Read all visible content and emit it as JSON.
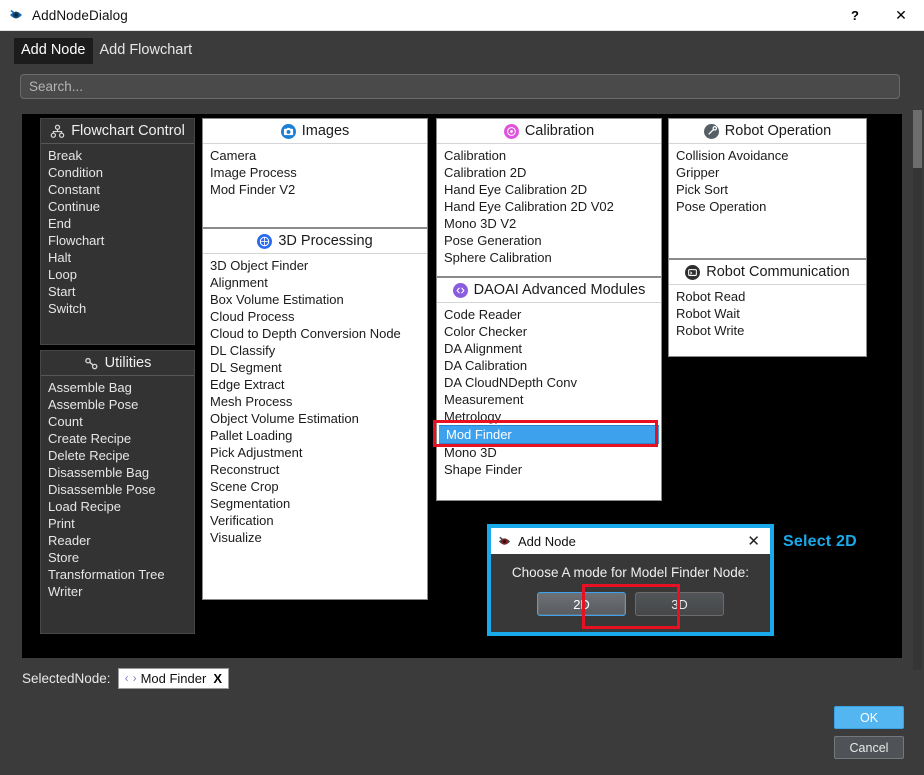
{
  "window": {
    "title": "AddNodeDialog",
    "icon": "app-eye-icon",
    "help_label": "?",
    "close_label": "✕"
  },
  "tabs": [
    {
      "label": "Add Node",
      "active": true
    },
    {
      "label": "Add Flowchart",
      "active": false
    }
  ],
  "search": {
    "placeholder": "Search...",
    "value": ""
  },
  "panels": {
    "flowchart_control": {
      "title": "Flowchart Control",
      "icon": "sitemap-icon",
      "items": [
        "Break",
        "Condition",
        "Constant",
        "Continue",
        "End",
        "Flowchart",
        "Halt",
        "Loop",
        "Start",
        "Switch"
      ]
    },
    "utilities": {
      "title": "Utilities",
      "icon": "wrench-icon",
      "items": [
        "Assemble Bag",
        "Assemble Pose",
        "Count",
        "Create Recipe",
        "Delete Recipe",
        "Disassemble Bag",
        "Disassemble Pose",
        "Load Recipe",
        "Print",
        "Reader",
        "Store",
        "Transformation Tree",
        "Writer"
      ]
    },
    "images": {
      "title": "Images",
      "icon": "camera-icon",
      "icon_color": "#1a7fd4",
      "items": [
        "Camera",
        "Image Process",
        "Mod Finder V2"
      ]
    },
    "processing_3d": {
      "title": "3D Processing",
      "icon": "cube-icon",
      "icon_color": "#2a6cf0",
      "items": [
        "3D Object Finder",
        "Alignment",
        "Box Volume Estimation",
        "Cloud Process",
        "Cloud to Depth Conversion Node",
        "DL Classify",
        "DL Segment",
        "Edge Extract",
        "Mesh Process",
        "Object Volume Estimation",
        "Pallet Loading",
        "Pick Adjustment",
        "Reconstruct",
        "Scene Crop",
        "Segmentation",
        "Verification",
        "Visualize"
      ]
    },
    "calibration": {
      "title": "Calibration",
      "icon": "target-icon",
      "icon_color": "#e052e0",
      "items": [
        "Calibration",
        "Calibration 2D",
        "Hand Eye Calibration 2D",
        "Hand Eye Calibration 2D V02",
        "Mono 3D V2",
        "Pose Generation",
        "Sphere Calibration"
      ]
    },
    "daoai_advanced": {
      "title": "DAOAI Advanced Modules",
      "icon": "code-brackets-icon",
      "icon_color": "#8a5ce0",
      "items": [
        "Code Reader",
        "Color Checker",
        "DA Alignment",
        "DA Calibration",
        "DA CloudNDepth Conv",
        "Measurement",
        "Metrology",
        "Mod Finder",
        "Mono 3D",
        "Shape Finder"
      ],
      "selected_item": "Mod Finder"
    },
    "robot_operation": {
      "title": "Robot Operation",
      "icon": "wrench-round-icon",
      "icon_color": "#555f66",
      "items": [
        "Collision Avoidance",
        "Gripper",
        "Pick Sort",
        "Pose Operation"
      ]
    },
    "robot_communication": {
      "title": "Robot Communication",
      "icon": "terminal-icon",
      "icon_color": "#2e2e2e",
      "items": [
        "Robot Read",
        "Robot Wait",
        "Robot Write"
      ]
    }
  },
  "add_node_dialog": {
    "title": "Add Node",
    "icon": "app-eye-icon",
    "close_label": "✕",
    "prompt": "Choose A mode for Model Finder Node:",
    "buttons": [
      {
        "label": "2D",
        "selected": true
      },
      {
        "label": "3D",
        "selected": false
      }
    ]
  },
  "annotation": {
    "label": "Select 2D",
    "color": "#18aaea",
    "box_color": "#e81123"
  },
  "footer": {
    "selected_node_label": "SelectedNode:",
    "chip": {
      "prev_arrow": "‹",
      "next_arrow": "›",
      "text": "Mod Finder",
      "remove_label": "X"
    },
    "ok_label": "OK",
    "cancel_label": "Cancel"
  }
}
